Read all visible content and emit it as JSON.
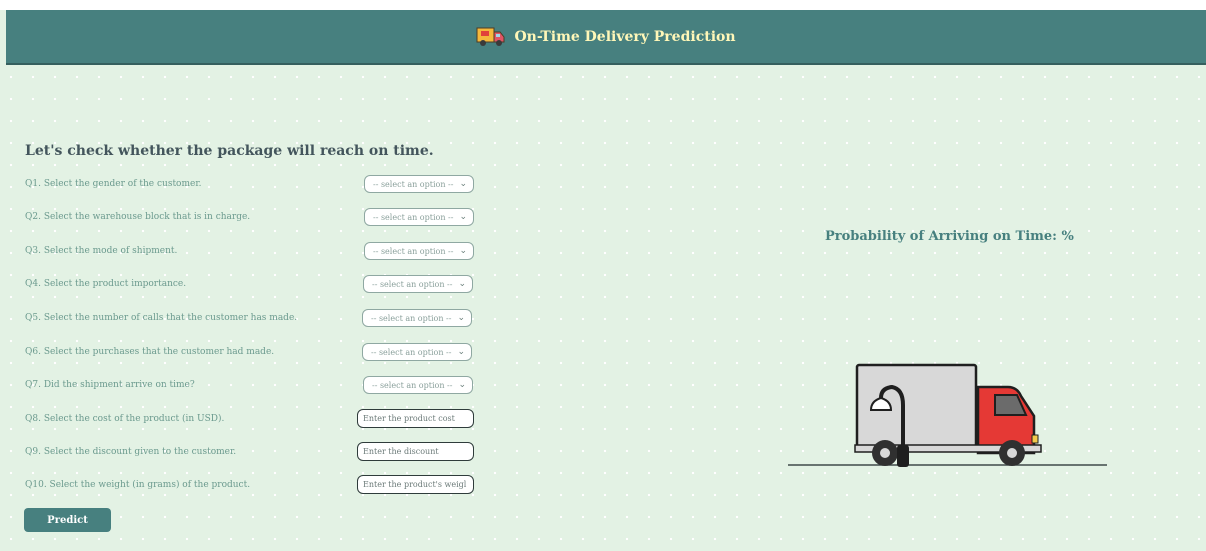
{
  "header": {
    "title": "On-Time Delivery Prediction"
  },
  "form": {
    "heading": "Let's check whether the package will reach on time.",
    "questions": [
      {
        "label": "Q1. Select the gender of the customer.",
        "type": "select",
        "value": "-- select an option --"
      },
      {
        "label": "Q2. Select the warehouse block that is in charge.",
        "type": "select",
        "value": "-- select an option --"
      },
      {
        "label": "Q3. Select the mode of shipment.",
        "type": "select",
        "value": "-- select an option --"
      },
      {
        "label": "Q4. Select the product importance.",
        "type": "select",
        "value": "-- select an option --"
      },
      {
        "label": "Q5. Select the number of calls that the customer has made.",
        "type": "select",
        "value": "-- select an option --"
      },
      {
        "label": "Q6. Select the purchases that the customer had made.",
        "type": "select",
        "value": "-- select an option --"
      },
      {
        "label": "Q7. Did the shipment arrive on time?",
        "type": "select",
        "value": "-- select an option --"
      },
      {
        "label": "Q8. Select the cost of the product (in USD).",
        "type": "input",
        "placeholder": "Enter the product cost"
      },
      {
        "label": "Q9. Select the discount given to the customer.",
        "type": "input",
        "placeholder": "Enter the discount"
      },
      {
        "label": "Q10. Select the weight (in grams) of the product.",
        "type": "input",
        "placeholder": "Enter the product's weigl"
      }
    ],
    "predict_label": "Predict"
  },
  "result": {
    "text": "Probability of Arriving on Time: %"
  },
  "colors": {
    "header": "#47807f",
    "header_text": "#fff7b8",
    "background": "#e3f2e4",
    "truck_cab": "#e53935"
  },
  "icons": {
    "header": "delivery-truck-icon",
    "select": "chevron-down-icon"
  }
}
